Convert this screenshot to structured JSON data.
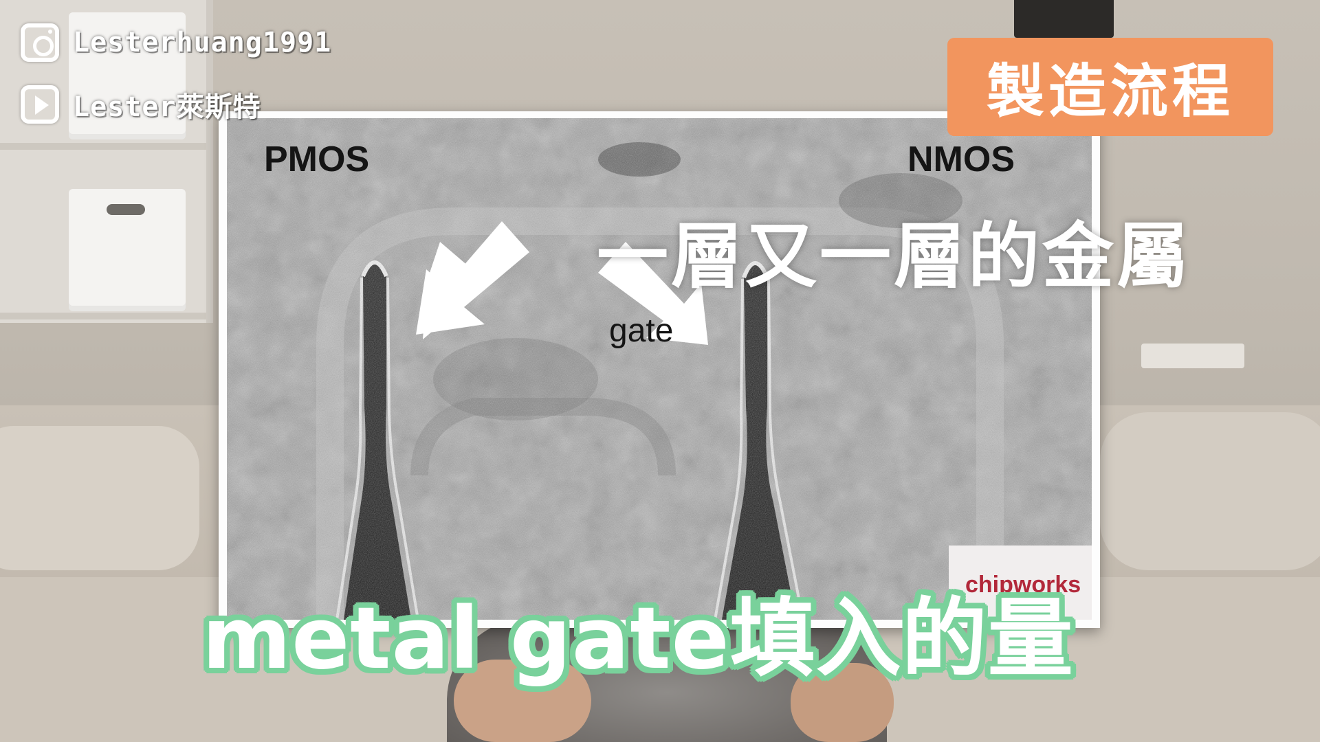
{
  "social": {
    "instagram_icon": "instagram-icon",
    "instagram_handle": "Lesterhuang1991",
    "youtube_icon": "youtube-play-icon",
    "youtube_channel": "Lester萊斯特"
  },
  "chapter_tag": {
    "label": "製造流程",
    "background": "#f2955e"
  },
  "annotation": {
    "text": "一層又一層的金屬"
  },
  "tem_image": {
    "pmos_label": "PMOS",
    "nmos_label": "NMOS",
    "gate_label": "gate",
    "watermark": "chipworks"
  },
  "subtitle": {
    "text": "metal gate填入的量",
    "outline_color": "#79d19b"
  }
}
